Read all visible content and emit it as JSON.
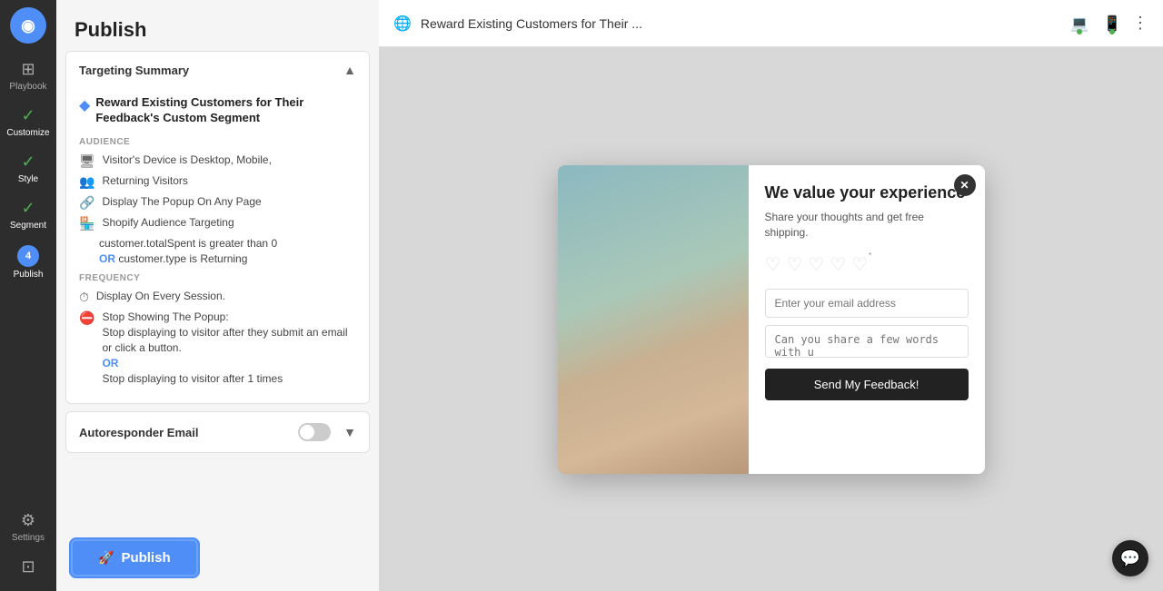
{
  "app": {
    "title": "Reward Existing Customers for Their ...",
    "logoColor": "#4f8ef7"
  },
  "topbar": {
    "title": "Reward Existing Customers for Their ...",
    "globe_icon": "🌐",
    "more_icon": "⋮"
  },
  "sidebar": {
    "items": [
      {
        "label": "Playbook",
        "icon": "⊞",
        "active": false
      },
      {
        "label": "Customize",
        "icon": "✓",
        "active": false
      },
      {
        "label": "Style",
        "icon": "✓",
        "active": false
      },
      {
        "label": "Segment",
        "icon": "✓",
        "active": false
      },
      {
        "label": "Publish",
        "icon": "4",
        "active": true
      }
    ],
    "settings_label": "Settings"
  },
  "publish": {
    "header": "Publish",
    "targeting_summary": {
      "title": "Targeting Summary",
      "campaign_name": "Reward Existing Customers for Their Feedback's Custom Segment",
      "audience_label": "AUDIENCE",
      "audience_items": [
        {
          "icon": "🖥",
          "text": "Visitor's Device is Desktop, Mobile,"
        },
        {
          "icon": "👥",
          "text": "Returning Visitors"
        },
        {
          "icon": "🔗",
          "text": "Display The Popup On Any Page"
        },
        {
          "icon": "🏪",
          "text": "Shopify Audience Targeting"
        },
        {
          "text": "customer.totalSpent is greater than 0",
          "or_text": "OR",
          "text2": "customer.type is Returning"
        }
      ],
      "frequency_label": "FREQUENCY",
      "frequency_items": [
        {
          "icon": "⏱",
          "text": "Display On Every Session."
        },
        {
          "icon": "🚫",
          "text": "Stop Showing The Popup:",
          "detail": "Stop displaying to visitor after they submit an email or click a button.",
          "or_text": "OR",
          "detail2": "Stop displaying to visitor after 1 times"
        }
      ]
    },
    "autoresponder": {
      "title": "Autoresponder Email"
    },
    "publish_button": "Publish"
  },
  "popup": {
    "title": "We value your experience",
    "subtitle": "Share your thoughts and get free shipping.",
    "email_placeholder": "Enter your email address",
    "textarea_placeholder": "Can you share a few words with u",
    "submit_label": "Send My Feedback!",
    "close_icon": "✕"
  },
  "colors": {
    "accent": "#4f8ef7",
    "dark": "#222222",
    "light_border": "#e0e0e0"
  }
}
